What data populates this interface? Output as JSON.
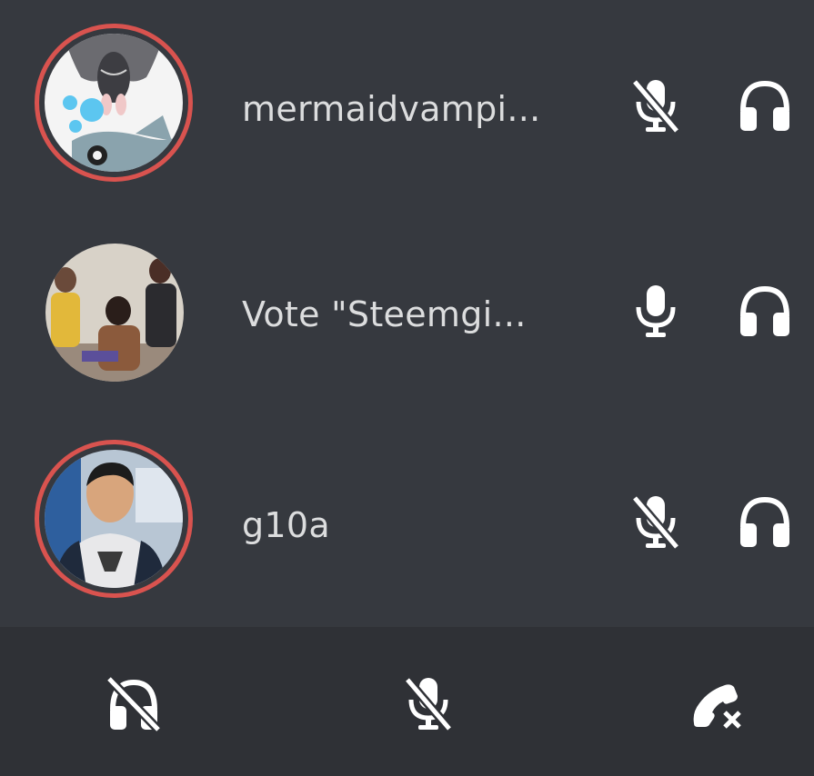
{
  "colors": {
    "background": "#36393f",
    "control_bar": "#2f3136",
    "speaking_ring": "#d9534f",
    "text": "#dcddde",
    "icon": "#ffffff"
  },
  "participants": [
    {
      "name": "mermaidvampi...",
      "avatar": "bat-and-fish-cartoon-avatar",
      "speaking_ring": true,
      "mic_icon": "mic-muted-icon",
      "headset_icon": "headset-icon"
    },
    {
      "name": "Vote \"Steemgi...",
      "avatar": "group-photo-avatar",
      "speaking_ring": false,
      "mic_icon": "mic-icon",
      "headset_icon": "headset-icon"
    },
    {
      "name": "g10a",
      "avatar": "selfie-photo-avatar",
      "speaking_ring": true,
      "mic_icon": "mic-muted-icon",
      "headset_icon": "headset-icon"
    }
  ],
  "controls": {
    "deafen_icon": "headset-deafened-icon",
    "mute_icon": "mic-muted-icon",
    "disconnect_icon": "phone-hangup-icon"
  }
}
